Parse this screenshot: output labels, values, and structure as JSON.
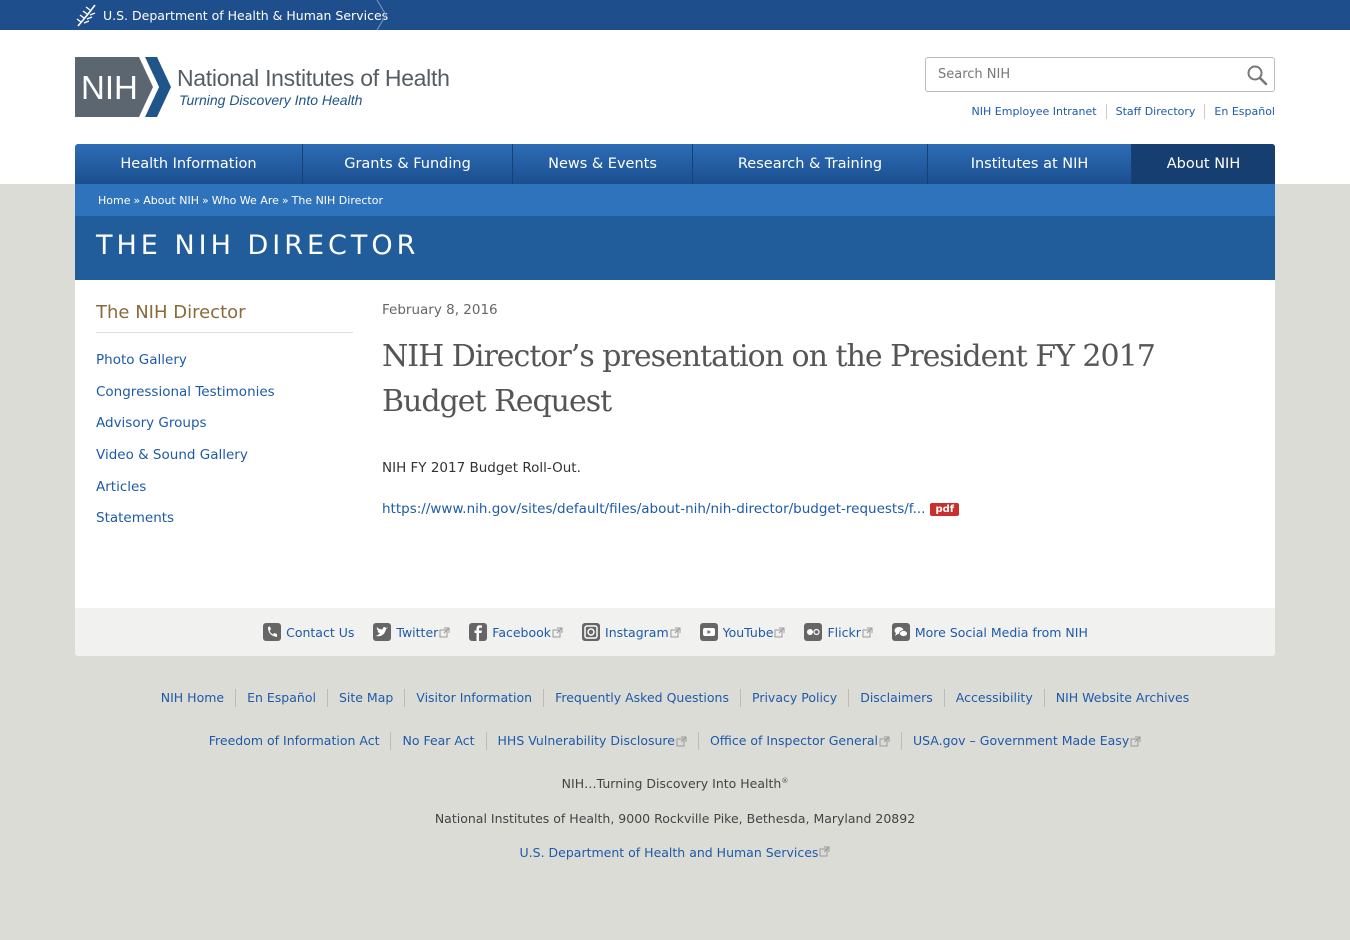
{
  "hhs": {
    "label": "U.S. Department of Health & Human Services"
  },
  "logo": {
    "wordmark": "NIH",
    "title": "National Institutes of Health",
    "tagline": "Turning Discovery Into Health"
  },
  "search": {
    "placeholder": "Search NIH"
  },
  "utility_links": [
    "NIH Employee Intranet",
    "Staff Directory",
    "En Español"
  ],
  "nav": {
    "items": [
      "Health Information",
      "Grants & Funding",
      "News & Events",
      "Research & Training",
      "Institutes at NIH",
      "About NIH"
    ],
    "active": "About NIH"
  },
  "breadcrumb": [
    "Home",
    "About NIH",
    "Who We Are",
    "The NIH Director"
  ],
  "breadcrumb_separator": "»",
  "page_title": "THE NIH DIRECTOR",
  "sidebar": {
    "title": "The NIH Director",
    "items": [
      "Photo Gallery",
      "Congressional Testimonies",
      "Advisory Groups",
      "Video & Sound Gallery",
      "Articles",
      "Statements"
    ]
  },
  "article": {
    "date": "February 8, 2016",
    "title": "NIH Director’s presentation on the President FY 2017 Budget Request",
    "body": "NIH FY 2017 Budget Roll-Out.",
    "link_text": "https://www.nih.gov/sites/default/files/about-nih/nih-director/budget-requests/f...",
    "badge": "pdf"
  },
  "social": [
    {
      "label": "Contact Us",
      "icon": "phone-icon",
      "external": false
    },
    {
      "label": "Twitter",
      "icon": "twitter-icon",
      "external": true
    },
    {
      "label": "Facebook",
      "icon": "facebook-icon",
      "external": true
    },
    {
      "label": "Instagram",
      "icon": "instagram-icon",
      "external": true
    },
    {
      "label": "YouTube",
      "icon": "youtube-icon",
      "external": true
    },
    {
      "label": "Flickr",
      "icon": "flickr-icon",
      "external": true
    },
    {
      "label": "More Social Media from NIH",
      "icon": "chat-bubbles-icon",
      "external": false
    }
  ],
  "footer": {
    "row1": [
      "NIH Home",
      "En Español",
      "Site Map",
      "Visitor Information",
      "Frequently Asked Questions",
      "Privacy Policy",
      "Disclaimers",
      "Accessibility",
      "NIH Website Archives"
    ],
    "row2": [
      {
        "label": "Freedom of Information Act",
        "external": false
      },
      {
        "label": "No Fear Act",
        "external": false
      },
      {
        "label": "HHS Vulnerability Disclosure",
        "external": true
      },
      {
        "label": "Office of Inspector General",
        "external": true
      },
      {
        "label": "USA.gov – Government Made Easy",
        "external": true
      }
    ],
    "tagline": "NIH…Turning Discovery Into Health",
    "tagline_mark": "®",
    "address": "National Institutes of Health, 9000 Rockville Pike, Bethesda, Maryland 20892",
    "hhs_link": "U.S. Department of Health and Human Services"
  },
  "colors": {
    "top_bar": "#1f4e8c",
    "nav": "#1b4f8f",
    "banner": "#215c9b",
    "breadcrumb_bar": "#2e73bb",
    "link": "#1e5aa8",
    "sidebar_title": "#8a6a3b",
    "pdf_badge": "#c9302c"
  }
}
